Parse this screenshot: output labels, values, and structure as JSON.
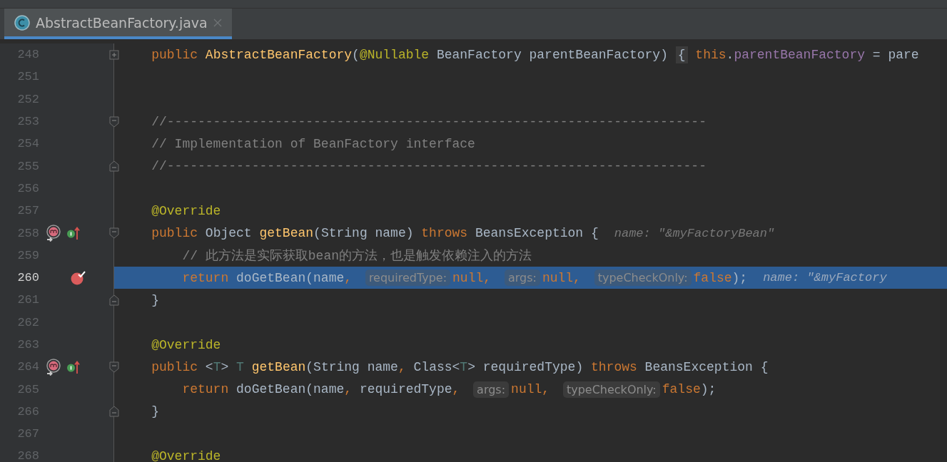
{
  "tabs": [
    {
      "label": "AbstractBeanFactory.java",
      "selected": true
    }
  ],
  "lines": [
    {
      "number": "248",
      "current": false,
      "breakpoint": false,
      "fold": {
        "kind": "collapsed"
      },
      "tokens": [
        {
          "kind": "keyword",
          "text": "    public "
        },
        {
          "kind": "method",
          "text": "AbstractBeanFactory"
        },
        {
          "kind": "plain",
          "text": "("
        },
        {
          "kind": "annotation",
          "text": "@Nullable"
        },
        {
          "kind": "plain",
          "text": " BeanFactory parentBeanFactory) "
        },
        {
          "kind": "folded",
          "text": "{"
        },
        {
          "kind": "keyword",
          "text": " this"
        },
        {
          "kind": "plain",
          "text": "."
        },
        {
          "kind": "field",
          "text": "parentBeanFactory"
        },
        {
          "kind": "plain",
          "text": " = pare"
        }
      ]
    },
    {
      "number": "251",
      "current": false,
      "breakpoint": false
    },
    {
      "number": "252",
      "current": false,
      "breakpoint": false
    },
    {
      "number": "253",
      "current": false,
      "breakpoint": false,
      "fold": {
        "kind": "start"
      },
      "tokens": [
        {
          "kind": "comment",
          "text": "    //----------------------------------------------------------------------"
        }
      ]
    },
    {
      "number": "254",
      "current": false,
      "breakpoint": false,
      "tokens": [
        {
          "kind": "comment",
          "text": "    // Implementation of BeanFactory interface"
        }
      ]
    },
    {
      "number": "255",
      "current": false,
      "breakpoint": false,
      "fold": {
        "kind": "end"
      },
      "tokens": [
        {
          "kind": "comment",
          "text": "    //----------------------------------------------------------------------"
        }
      ]
    },
    {
      "number": "256",
      "current": false,
      "breakpoint": false
    },
    {
      "number": "257",
      "current": false,
      "breakpoint": false,
      "tokens": [
        {
          "kind": "annotation",
          "text": "    @Override"
        }
      ]
    },
    {
      "number": "258",
      "current": false,
      "breakpoint": false,
      "fold": {
        "kind": "start"
      },
      "markers": [
        {
          "kind": "overriding"
        },
        {
          "kind": "implemented"
        }
      ],
      "tokens": [
        {
          "kind": "keyword",
          "text": "    public "
        },
        {
          "kind": "plain",
          "text": "Object "
        },
        {
          "kind": "method",
          "text": "getBean"
        },
        {
          "kind": "plain",
          "text": "(String name) "
        },
        {
          "kind": "keyword",
          "text": "throws "
        },
        {
          "kind": "plain",
          "text": "BeansException {"
        },
        {
          "kind": "inlay",
          "text": "name: \"&myFactoryBean\""
        }
      ]
    },
    {
      "number": "259",
      "current": false,
      "breakpoint": false,
      "tokens": [
        {
          "kind": "comment",
          "text": "        // 此方法是实际获取bean的方法，也是触发依赖注入的方法"
        }
      ]
    },
    {
      "number": "260",
      "current": true,
      "breakpoint": true,
      "tokens": [
        {
          "kind": "keyword",
          "text": "        return "
        },
        {
          "kind": "plain",
          "text": "doGetBean(name"
        },
        {
          "kind": "punct",
          "text": ", "
        },
        {
          "kind": "hint",
          "text": "requiredType:"
        },
        {
          "kind": "keyword",
          "text": "null"
        },
        {
          "kind": "punct",
          "text": ", "
        },
        {
          "kind": "hint",
          "text": "args:"
        },
        {
          "kind": "keyword",
          "text": "null"
        },
        {
          "kind": "punct",
          "text": ", "
        },
        {
          "kind": "hint",
          "text": "typeCheckOnly:"
        },
        {
          "kind": "keyword",
          "text": "false"
        },
        {
          "kind": "plain",
          "text": ");"
        },
        {
          "kind": "inlay",
          "text": "name: \"&myFactory"
        }
      ]
    },
    {
      "number": "261",
      "current": false,
      "breakpoint": false,
      "fold": {
        "kind": "end"
      },
      "tokens": [
        {
          "kind": "plain",
          "text": "    }"
        }
      ]
    },
    {
      "number": "262",
      "current": false,
      "breakpoint": false
    },
    {
      "number": "263",
      "current": false,
      "breakpoint": false,
      "tokens": [
        {
          "kind": "annotation",
          "text": "    @Override"
        }
      ]
    },
    {
      "number": "264",
      "current": false,
      "breakpoint": false,
      "fold": {
        "kind": "start"
      },
      "markers": [
        {
          "kind": "overriding"
        },
        {
          "kind": "implemented"
        }
      ],
      "tokens": [
        {
          "kind": "keyword",
          "text": "    public "
        },
        {
          "kind": "plain",
          "text": "<"
        },
        {
          "kind": "typeparam",
          "text": "T"
        },
        {
          "kind": "plain",
          "text": "> "
        },
        {
          "kind": "typeparam",
          "text": "T "
        },
        {
          "kind": "method",
          "text": "getBean"
        },
        {
          "kind": "plain",
          "text": "(String name"
        },
        {
          "kind": "punct",
          "text": ", "
        },
        {
          "kind": "plain",
          "text": "Class<"
        },
        {
          "kind": "typeparam",
          "text": "T"
        },
        {
          "kind": "plain",
          "text": "> requiredType) "
        },
        {
          "kind": "keyword",
          "text": "throws "
        },
        {
          "kind": "plain",
          "text": "BeansException {"
        }
      ]
    },
    {
      "number": "265",
      "current": false,
      "breakpoint": false,
      "tokens": [
        {
          "kind": "keyword",
          "text": "        return "
        },
        {
          "kind": "plain",
          "text": "doGetBean(name"
        },
        {
          "kind": "punct",
          "text": ", "
        },
        {
          "kind": "plain",
          "text": "requiredType"
        },
        {
          "kind": "punct",
          "text": ", "
        },
        {
          "kind": "hint",
          "text": "args:"
        },
        {
          "kind": "keyword",
          "text": "null"
        },
        {
          "kind": "punct",
          "text": ", "
        },
        {
          "kind": "hint",
          "text": "typeCheckOnly:"
        },
        {
          "kind": "keyword",
          "text": "false"
        },
        {
          "kind": "plain",
          "text": ");"
        }
      ]
    },
    {
      "number": "266",
      "current": false,
      "breakpoint": false,
      "fold": {
        "kind": "end"
      },
      "tokens": [
        {
          "kind": "plain",
          "text": "    }"
        }
      ]
    },
    {
      "number": "267",
      "current": false,
      "breakpoint": false
    },
    {
      "number": "268",
      "current": false,
      "breakpoint": false,
      "tokens": [
        {
          "kind": "annotation",
          "text": "    @Override"
        }
      ]
    }
  ]
}
